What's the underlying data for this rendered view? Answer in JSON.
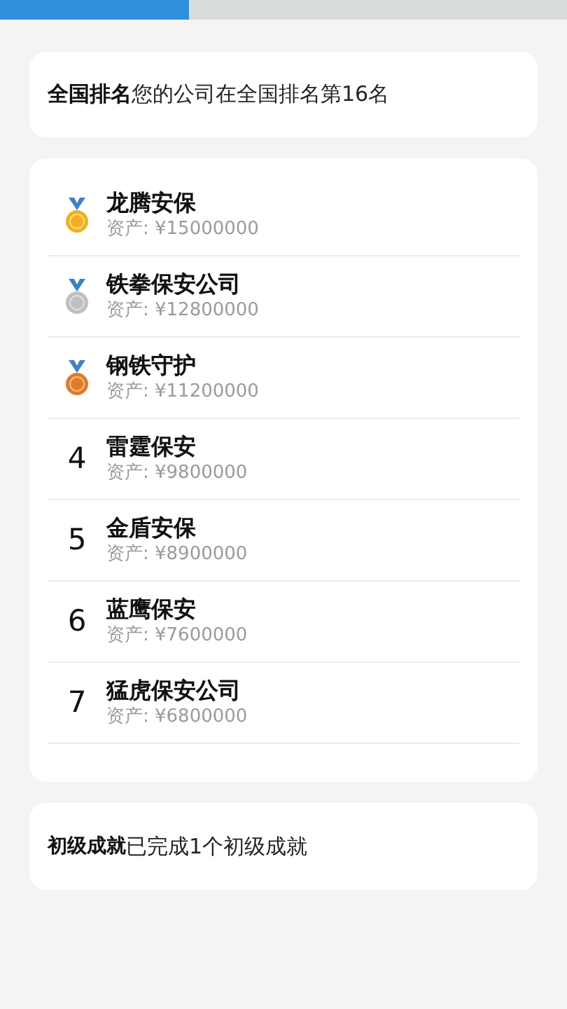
{
  "progress": {
    "level": 0.333
  },
  "national_rank": {
    "label": "全国排名",
    "text": "您的公司在全国排名第16名"
  },
  "ranking": [
    {
      "kind": "medal",
      "color": "#f2b01e",
      "name": "龙腾安保",
      "assets": "资产: ¥15000000"
    },
    {
      "kind": "medal",
      "color": "#bfbfbf",
      "name": "铁拳保安公司",
      "assets": "资产: ¥12800000"
    },
    {
      "kind": "medal",
      "color": "#e07b2a",
      "name": "钢铁守护",
      "assets": "资产: ¥11200000"
    },
    {
      "kind": "number",
      "rank": "4",
      "name": "雷霆保安",
      "assets": "资产: ¥9800000"
    },
    {
      "kind": "number",
      "rank": "5",
      "name": "金盾安保",
      "assets": "资产: ¥8900000"
    },
    {
      "kind": "number",
      "rank": "6",
      "name": "蓝鹰保安",
      "assets": "资产: ¥7600000"
    },
    {
      "kind": "number",
      "rank": "7",
      "name": "猛虎保安公司",
      "assets": "资产: ¥6800000"
    }
  ],
  "achievements": {
    "label": "初级成就",
    "text": "已完成1个初级成就"
  }
}
